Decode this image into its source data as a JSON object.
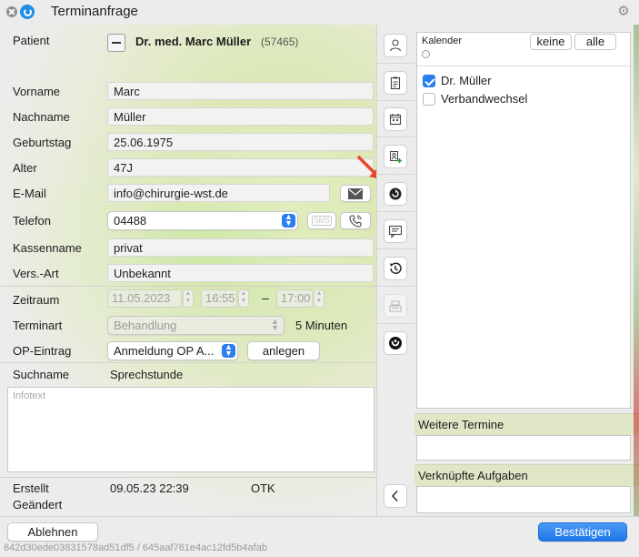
{
  "window": {
    "title": "Terminanfrage"
  },
  "patient": {
    "label": "Patient",
    "name": "Dr. med. Marc Müller",
    "id": "(57465)"
  },
  "fields": {
    "vorname": {
      "label": "Vorname",
      "value": "Marc"
    },
    "nachname": {
      "label": "Nachname",
      "value": "Müller"
    },
    "geburtstag": {
      "label": "Geburtstag",
      "value": "25.06.1975"
    },
    "alter": {
      "label": "Alter",
      "value": "47J"
    },
    "email": {
      "label": "E-Mail",
      "value": "info@chirurgie-wst.de"
    },
    "telefon": {
      "label": "Telefon",
      "value": "04488"
    },
    "kassenname": {
      "label": "Kassenname",
      "value": "privat"
    },
    "versart": {
      "label": "Vers.-Art",
      "value": "Unbekannt"
    }
  },
  "zeitraum": {
    "label": "Zeitraum",
    "date": "11.05.2023",
    "from": "16:55",
    "dash": "–",
    "to": "17:00"
  },
  "terminart": {
    "label": "Terminart",
    "value": "Behandlung",
    "duration": "5 Minuten"
  },
  "op": {
    "label": "OP-Eintrag",
    "value": "Anmeldung OP A...",
    "button": "anlegen"
  },
  "suchname": {
    "label": "Suchname",
    "value": "Sprechstunde"
  },
  "infotext": {
    "placeholder": "Infotext"
  },
  "meta": {
    "erstellt_label": "Erstellt",
    "erstellt_value": "09.05.23 22:39",
    "erstellt_user": "OTK",
    "geaendert_label": "Geändert"
  },
  "sms_label": "SMS",
  "calendar": {
    "label": "Kalender",
    "btn_none": "keine",
    "btn_all": "alle",
    "items": [
      {
        "label": "Dr. Müller",
        "checked": true
      },
      {
        "label": "Verbandwechsel",
        "checked": false
      }
    ]
  },
  "weitere": {
    "label": "Weitere Termine"
  },
  "verknuepfte": {
    "label": "Verknüpfte Aufgaben"
  },
  "footer": {
    "reject": "Ablehnen",
    "confirm": "Bestätigen",
    "hash": "642d30ede03831578ad51df5 / 645aaf761e4ac12fd5b4afab"
  },
  "colors": {
    "accent": "#2a7ff0",
    "annotation_arrow": "#e8462b"
  }
}
